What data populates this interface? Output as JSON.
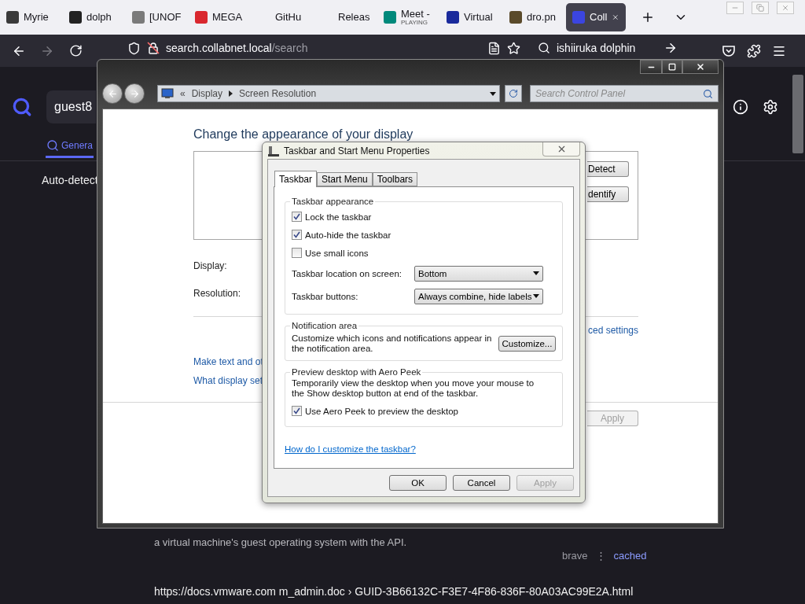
{
  "browser": {
    "tabs": [
      {
        "label": "Myrie",
        "selected": false,
        "color": "#3a3a3a"
      },
      {
        "label": "dolph",
        "selected": false,
        "color": "#222222"
      },
      {
        "label": "[UNOF",
        "selected": false,
        "color": "#7a7a7a"
      },
      {
        "label": "MEGA",
        "selected": false,
        "color": "#d9272e"
      },
      {
        "label": "GitHu",
        "selected": false
      },
      {
        "label": "Releas",
        "selected": false
      },
      {
        "label": "Meet -",
        "status": "PLAYING",
        "selected": false,
        "color": "#00897b"
      },
      {
        "label": "Virtual",
        "selected": false,
        "color": "#1a2a9c"
      },
      {
        "label": "dro.pn",
        "selected": false,
        "color": "#5a4a2a"
      },
      {
        "label": "Coll",
        "selected": true,
        "color": "#3b45e0"
      }
    ],
    "nav": {
      "back_disabled": false,
      "forward_disabled": true
    },
    "address": {
      "host": "search.collabnet.local",
      "path": "/search"
    },
    "search": {
      "value": "ishiiruka dolphin"
    }
  },
  "page": {
    "query": "guest8",
    "tabs": [
      {
        "label": "Genera",
        "selected": true
      }
    ],
    "notice": "Auto-detect",
    "snippet": "a virtual machine's guest operating system with the API.",
    "source": "brave",
    "separator": "⋮",
    "cached": "cached",
    "url": "https://docs.vmware.com  m_admin.doc › GUID-3B66132C-F3E7-4F86-836F-80A03AC99E2A.html"
  },
  "control_panel": {
    "breadcrumb_prefix": "«",
    "breadcrumb": [
      "Display",
      "Screen Resolution"
    ],
    "search_placeholder": "Search Control Panel",
    "heading": "Change the appearance of your display",
    "monitor_buttons": [
      "Detect",
      "dentify"
    ],
    "labels": [
      "Display:",
      "Resolution:"
    ],
    "advanced_link": "ced settings",
    "links": [
      "Make text and ot",
      "What display set"
    ],
    "apply": {
      "label": "Apply",
      "disabled": true
    }
  },
  "dialog": {
    "title": "Taskbar and Start Menu Properties",
    "tabs": [
      {
        "label": "Taskbar",
        "selected": true
      },
      {
        "label": "Start Menu",
        "selected": false
      },
      {
        "label": "Toolbars",
        "selected": false
      }
    ],
    "groups": [
      {
        "title": "Taskbar appearance",
        "items": [
          {
            "kind": "checkbox",
            "label": "Lock the taskbar",
            "checked": true
          },
          {
            "kind": "checkbox",
            "label": "Auto-hide the taskbar",
            "checked": true
          },
          {
            "kind": "checkbox",
            "label": "Use small icons",
            "checked": false
          },
          {
            "kind": "select",
            "label": "Taskbar location on screen:",
            "value": "Bottom"
          },
          {
            "kind": "select",
            "label": "Taskbar buttons:",
            "value": "Always combine, hide labels"
          }
        ]
      },
      {
        "title": "Notification area",
        "items": [
          {
            "kind": "text_button",
            "text": "Customize which icons and notifications appear in the notification area.",
            "button": "Customize..."
          }
        ]
      },
      {
        "title": "Preview desktop with Aero Peek",
        "items": [
          {
            "kind": "text",
            "text": "Temporarily view the desktop when you move your mouse to the Show desktop button at end of the taskbar."
          },
          {
            "kind": "checkbox",
            "label": "Use Aero Peek to preview the desktop",
            "checked": true
          }
        ]
      }
    ],
    "help_link": "How do I customize the taskbar?",
    "buttons": [
      {
        "label": "OK",
        "disabled": false
      },
      {
        "label": "Cancel",
        "disabled": false
      },
      {
        "label": "Apply",
        "disabled": true
      }
    ]
  }
}
